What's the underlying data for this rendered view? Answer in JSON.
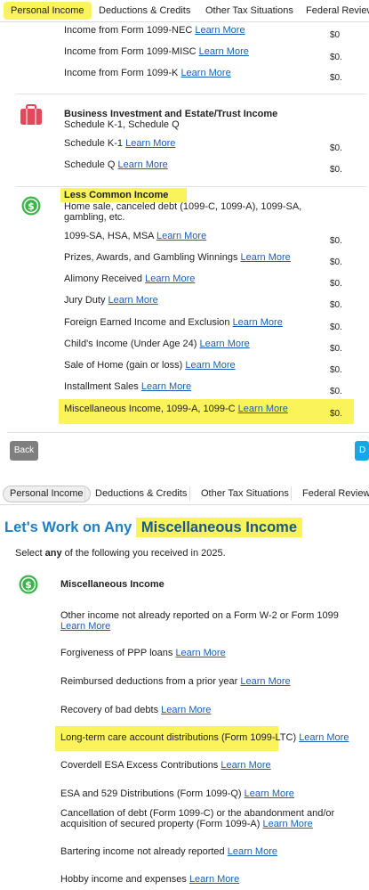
{
  "top_tabs": [
    "Personal Income",
    "Deductions & Credits",
    "Other Tax Situations",
    "Federal Review"
  ],
  "currency_rows": [
    {
      "label": "Income from Form 1099-NEC",
      "link": "Learn More",
      "amount": "$0"
    },
    {
      "label": "Income from Form 1099-MISC",
      "link": "Learn More",
      "amount": "$0."
    },
    {
      "label": "Income from Form 1099-K",
      "link": "Learn More",
      "amount": "$0."
    }
  ],
  "business": {
    "title": "Business Investment and Estate/Trust Income",
    "subtitle": "Schedule K-1, Schedule Q",
    "rows": [
      {
        "label": "Schedule K-1",
        "link": "Learn More",
        "amount": "$0."
      },
      {
        "label": "Schedule Q",
        "link": "Learn More",
        "amount": "$0."
      }
    ]
  },
  "less_common": {
    "title": "Less Common Income",
    "subtitle_line1": "Home sale, canceled debt (1099-C, 1099-A), 1099-SA,",
    "subtitle_line2": "gambling, etc.",
    "rows": [
      {
        "label": "1099-SA, HSA, MSA",
        "link": "Learn More",
        "amount": "$0."
      },
      {
        "label": "Prizes, Awards, and Gambling Winnings",
        "link": "Learn More",
        "amount": "$0."
      },
      {
        "label": "Alimony Received",
        "link": "Learn More",
        "amount": "$0."
      },
      {
        "label": "Jury Duty",
        "link": "Learn More",
        "amount": "$0."
      },
      {
        "label": "Foreign Earned Income and Exclusion",
        "link": "Learn More",
        "amount": "$0."
      },
      {
        "label": "Child's Income (Under Age 24)",
        "link": "Learn More",
        "amount": "$0."
      },
      {
        "label": "Sale of Home (gain or loss)",
        "link": "Learn More",
        "amount": "$0."
      },
      {
        "label": "Installment Sales",
        "link": "Learn More",
        "amount": "$0."
      },
      {
        "label": "Miscellaneous Income, 1099-A, 1099-C",
        "link": "Learn More",
        "amount": "$0."
      }
    ]
  },
  "buttons": {
    "back": "Back",
    "done": "D"
  },
  "page2": {
    "heading_prefix": "Let's Work on Any",
    "heading_highlight": "Miscellaneous Income",
    "instruction_pre": "Select ",
    "instruction_bold": "any",
    "instruction_post": " of the following you received in 2025.",
    "section_title": "Miscellaneous Income",
    "items": [
      {
        "label": "Other income not already reported on a Form W-2 or Form 1099",
        "label2": "",
        "link": "Learn More"
      },
      {
        "label": "Forgiveness of PPP loans",
        "label2": "",
        "link": "Learn More"
      },
      {
        "label": "Reimbursed deductions from a prior year",
        "label2": "",
        "link": "Learn More"
      },
      {
        "label": "Recovery of bad debts",
        "label2": "",
        "link": "Learn More"
      },
      {
        "label": "Long-term care account distributions (Form 1099-LTC)",
        "label2": "",
        "link": "Learn More"
      },
      {
        "label": "Coverdell ESA Excess Contributions",
        "label2": "",
        "link": "Learn More"
      },
      {
        "label": "ESA and 529 Distributions (Form 1099-Q)",
        "label2": "",
        "link": "Learn More"
      },
      {
        "label": "Cancellation of debt (Form 1099-C) or the abandonment and/or",
        "label2": "acquisition of secured property (Form 1099-A)",
        "link": "Learn More"
      },
      {
        "label": "Bartering income not already reported",
        "label2": "",
        "link": "Learn More"
      },
      {
        "label": "Hobby income and expenses",
        "label2": "",
        "link": "Learn More"
      }
    ]
  },
  "colors": {
    "highlight": "#fbf35a",
    "link": "#1a5fb4",
    "heading_blue": "#1f7fc0",
    "icon_green": "#3ab54a",
    "briefcase_red": "#e5475b"
  }
}
